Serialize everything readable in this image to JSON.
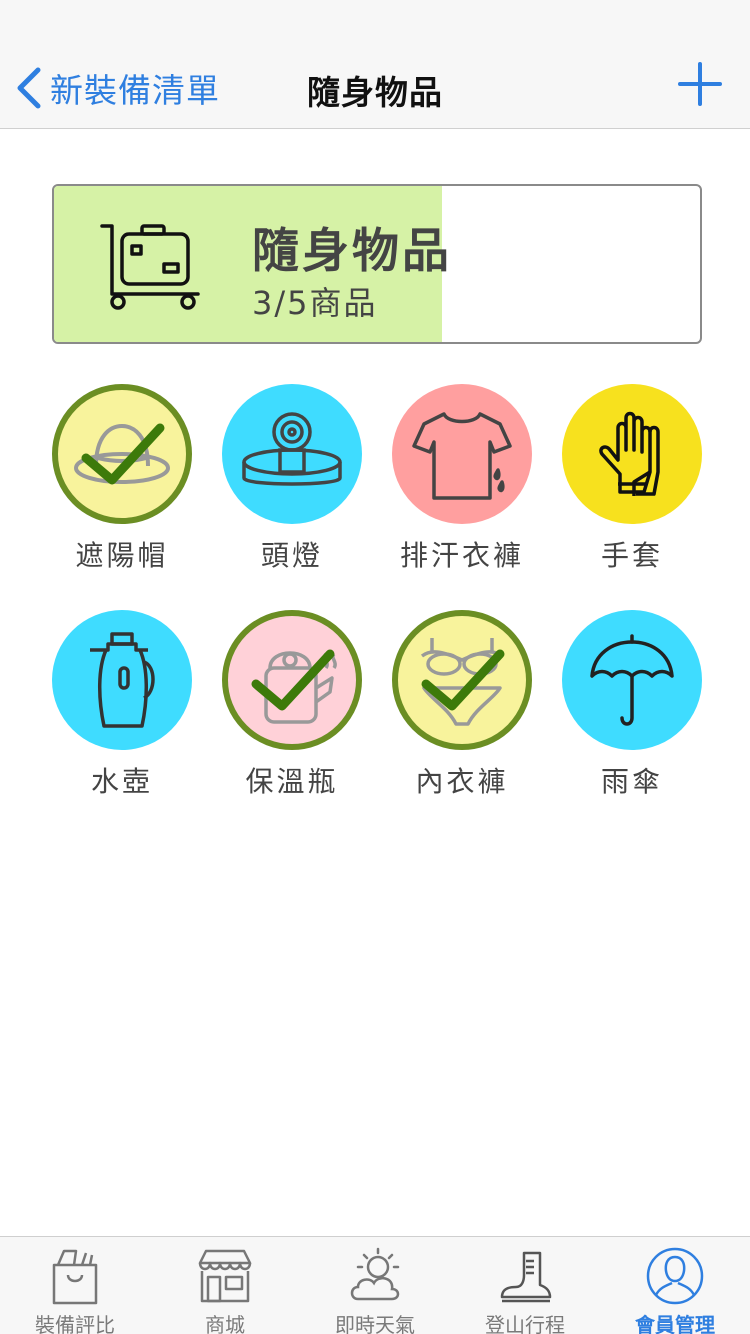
{
  "nav": {
    "back_label": "新裝備清單",
    "title": "隨身物品",
    "add_icon": "plus-icon"
  },
  "summary": {
    "title": "隨身物品",
    "count": "3/5商品",
    "progress": 0.6,
    "icon": "luggage-cart-icon",
    "fill_color": "#d6f2a6"
  },
  "items": [
    {
      "label": "遮陽帽",
      "icon": "sun-hat-icon",
      "bg": "#f8f39c",
      "checked": true
    },
    {
      "label": "頭燈",
      "icon": "headlamp-icon",
      "bg": "#3fdcff",
      "checked": false
    },
    {
      "label": "排汗衣褲",
      "icon": "tshirt-icon",
      "bg": "#ff9f9f",
      "checked": false
    },
    {
      "label": "手套",
      "icon": "gloves-icon",
      "bg": "#f7e11e",
      "checked": false
    },
    {
      "label": "水壺",
      "icon": "kettle-icon",
      "bg": "#3fdcff",
      "checked": false
    },
    {
      "label": "保溫瓶",
      "icon": "thermos-pot-icon",
      "bg": "#ffd1d8",
      "checked": true
    },
    {
      "label": "內衣褲",
      "icon": "underwear-icon",
      "bg": "#f8f39c",
      "checked": true
    },
    {
      "label": "雨傘",
      "icon": "umbrella-icon",
      "bg": "#3fdcff",
      "checked": false
    }
  ],
  "check_color": "#3d7a0a",
  "tabs": [
    {
      "label": "裝備評比",
      "icon": "shopping-bag-icon",
      "active": false
    },
    {
      "label": "商城",
      "icon": "storefront-icon",
      "active": false
    },
    {
      "label": "即時天氣",
      "icon": "weather-icon",
      "active": false
    },
    {
      "label": "登山行程",
      "icon": "hiking-boot-icon",
      "active": false
    },
    {
      "label": "會員管理",
      "icon": "member-icon",
      "active": true
    }
  ],
  "accent_color": "#2f7fe0"
}
